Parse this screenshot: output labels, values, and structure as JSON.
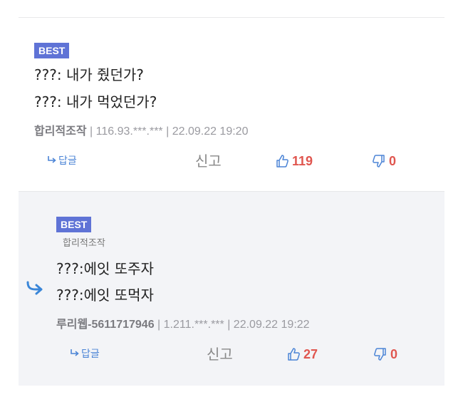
{
  "comments": [
    {
      "badge": "BEST",
      "lines": [
        "???: 내가 줬던가?",
        "???: 내가 먹었던가?"
      ],
      "author": "합리적조작",
      "ip": " | 116.93.***.*** | ",
      "datetime": "22.09.22 19:20",
      "reply_label": "답글",
      "report_label": "신고",
      "likes": "119",
      "dislikes": "0"
    },
    {
      "badge": "BEST",
      "reply_to": "합리적조작",
      "lines": [
        "???:에잇 또주자",
        "???:에잇 또먹자"
      ],
      "author": "루리웹-5611717946",
      "ip": " | 1.211.***.*** | ",
      "datetime": "22.09.22 19:22",
      "reply_label": "답글",
      "report_label": "신고",
      "likes": "27",
      "dislikes": "0"
    }
  ],
  "colors": {
    "badge": "#5f73d6",
    "vote_count": "#e0564f",
    "reply_link": "#4b84d6",
    "thumb_icon": "#4b84d6"
  },
  "icons": {
    "reply": "reply-arrow-icon",
    "like": "thumbs-up-icon",
    "dislike": "thumbs-down-icon"
  }
}
